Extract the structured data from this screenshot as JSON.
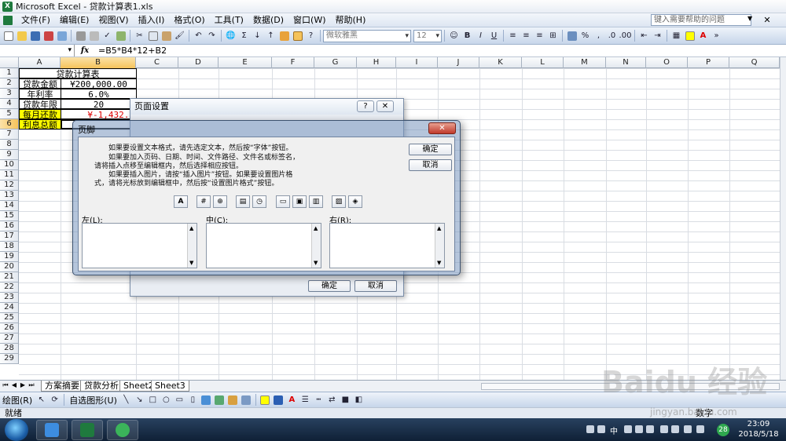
{
  "window": {
    "title": "Microsoft Excel - 贷款计算表1.xls",
    "app_icon": "X"
  },
  "menu": {
    "items": [
      "文件(F)",
      "编辑(E)",
      "视图(V)",
      "插入(I)",
      "格式(O)",
      "工具(T)",
      "数据(D)",
      "窗口(W)",
      "帮助(H)"
    ],
    "help_placeholder": "键入需要帮助的问题"
  },
  "toolbar": {
    "font": "微软雅黑",
    "size": "12",
    "percent": "%"
  },
  "formula_bar": {
    "name_box": "",
    "fx": "fx",
    "formula": "=B5*B4*12+B2"
  },
  "columns": [
    "A",
    "B",
    "C",
    "D",
    "E",
    "F",
    "G",
    "H",
    "I",
    "J",
    "K",
    "L",
    "M",
    "N",
    "O",
    "P",
    "Q"
  ],
  "rows": [
    "1",
    "2",
    "3",
    "4",
    "5",
    "6",
    "7",
    "8",
    "9",
    "10",
    "11",
    "12",
    "13",
    "14",
    "15",
    "16",
    "17",
    "18",
    "19",
    "20",
    "21",
    "22",
    "23",
    "24",
    "25",
    "26",
    "27",
    "28",
    "29"
  ],
  "cells": {
    "title": "贷款计算表",
    "loan_amount_label": "贷款金额",
    "loan_amount_value": "¥200,000.00",
    "rate_label": "年利率",
    "rate_value": "6.0%",
    "years_label": "贷款年限",
    "years_value": "20",
    "monthly_label": "每月还款",
    "monthly_value": "¥-1,432.8",
    "interest_label": "利息总额"
  },
  "sheet_tabs": [
    "方案摘要",
    "贷款分析",
    "Sheet2",
    "Sheet3"
  ],
  "draw_toolbar": {
    "draw": "绘图(R)",
    "autoshapes": "自选图形(U)"
  },
  "status": {
    "left": "就绪",
    "right": "数字"
  },
  "page_setup_dialog": {
    "title": "页面设置",
    "help": "?",
    "ok": "确定",
    "cancel": "取消"
  },
  "footer_dialog": {
    "title": "页脚",
    "instructions": [
      "如果要设置文本格式，请先选定文本，然后按“字体”按钮。",
      "如果要加入页码、日期、时间、文件路径、文件名或标签名，",
      "请将插入点移至编辑框内，然后选择相应按钮。",
      "如果要插入图片，请按“插入图片”按钮。如果要设置图片格",
      "式，请将光标放到编辑框中，然后按“设置图片格式”按钮。"
    ],
    "ok": "确定",
    "cancel": "取消",
    "left_label": "左(L):",
    "center_label": "中(C):",
    "right_label": "右(R):",
    "font_button": "A"
  },
  "tray": {
    "lang": "中",
    "badge": "28",
    "time": "23:09",
    "date": "2018/5/18"
  },
  "watermark": {
    "main": "Baidu 经验",
    "url": "jingyan.baidu.com"
  }
}
